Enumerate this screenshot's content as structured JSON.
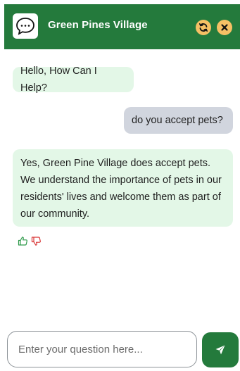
{
  "header": {
    "title": "Green Pines Village",
    "logo_icon": "chat-bubble-icon",
    "refresh_icon": "refresh-icon",
    "close_icon": "close-icon"
  },
  "messages": [
    {
      "role": "bot",
      "text": "Hello, How Can I Help?"
    },
    {
      "role": "user",
      "text": "do you accept pets?"
    },
    {
      "role": "bot",
      "text": "Yes, Green Pine Village does accept pets. We understand the importance of pets in our residents' lives and welcome them as part of our community."
    }
  ],
  "feedback": {
    "like_icon": "thumbs-up-icon",
    "dislike_icon": "thumbs-down-icon"
  },
  "composer": {
    "placeholder": "Enter your question here...",
    "send_icon": "send-icon"
  },
  "colors": {
    "brand": "#247a3c",
    "bot_bubble": "#e3f7e7",
    "user_bubble": "#d1d5de",
    "header_button": "#f6c065",
    "like": "#2e9a4a",
    "dislike": "#d93636"
  }
}
